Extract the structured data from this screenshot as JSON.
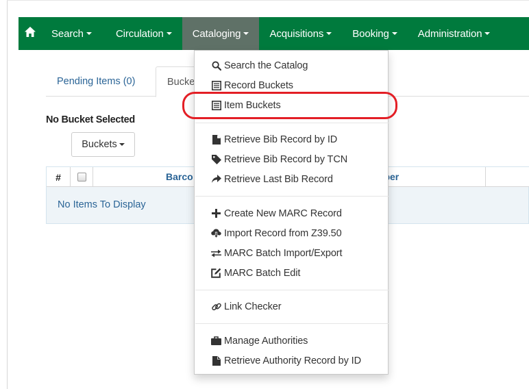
{
  "navbar": {
    "home_icon": "home-icon",
    "items": [
      {
        "label": "Search"
      },
      {
        "label": "Circulation"
      },
      {
        "label": "Cataloging"
      },
      {
        "label": "Acquisitions"
      },
      {
        "label": "Booking"
      },
      {
        "label": "Administration"
      }
    ],
    "active": "Cataloging",
    "color": "#007a3d",
    "active_color": "#5f7167"
  },
  "tabs": {
    "pending": "Pending Items (0)",
    "buckets": "Bucke"
  },
  "bucket_status": "No Bucket Selected",
  "buckets_button": "Buckets",
  "grid": {
    "columns": [
      "#",
      "",
      "Barco",
      "mber"
    ],
    "empty_text": "No Items To Display"
  },
  "cataloging_menu": {
    "groups": [
      [
        {
          "label": "Search the Catalog",
          "icon": "search-icon"
        },
        {
          "label": "Record Buckets",
          "icon": "list-icon"
        },
        {
          "label": "Item Buckets",
          "icon": "list-icon"
        }
      ],
      [
        {
          "label": "Retrieve Bib Record by ID",
          "icon": "file-icon"
        },
        {
          "label": "Retrieve Bib Record by TCN",
          "icon": "tag-icon"
        },
        {
          "label": "Retrieve Last Bib Record",
          "icon": "share-arrow-icon"
        }
      ],
      [
        {
          "label": "Create New MARC Record",
          "icon": "plus-icon"
        },
        {
          "label": "Import Record from Z39.50",
          "icon": "cloud-download-icon"
        },
        {
          "label": "MARC Batch Import/Export",
          "icon": "transfer-icon"
        },
        {
          "label": "MARC Batch Edit",
          "icon": "edit-icon"
        }
      ],
      [
        {
          "label": "Link Checker",
          "icon": "link-icon"
        }
      ],
      [
        {
          "label": "Manage Authorities",
          "icon": "briefcase-icon"
        },
        {
          "label": "Retrieve Authority Record by ID",
          "icon": "file-icon"
        }
      ]
    ],
    "highlighted_item": "Item Buckets",
    "highlight_color": "#e31e25"
  }
}
